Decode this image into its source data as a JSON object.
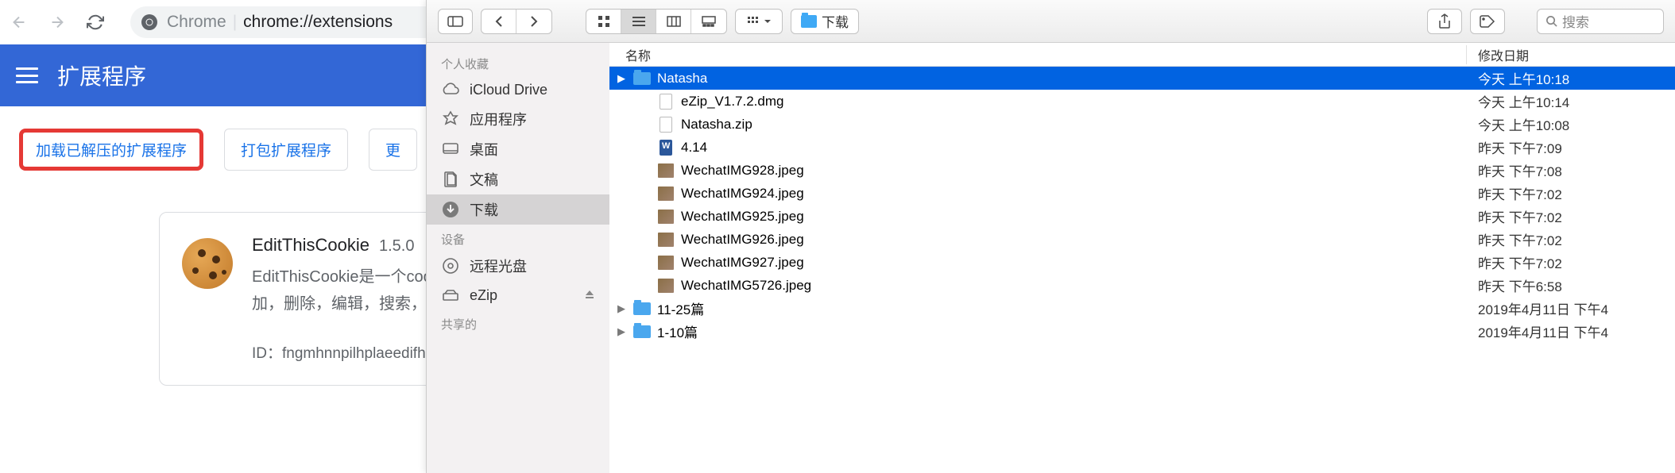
{
  "chrome": {
    "addr_prefix": "Chrome",
    "addr_path": "chrome://extensions",
    "header_title": "扩展程序",
    "btn_load": "加载已解压的扩展程序",
    "btn_pack": "打包扩展程序",
    "btn_update": "更",
    "card": {
      "title": "EditThisCookie",
      "version": "1.5.0",
      "desc1": "EditThisCookie是一个cookie管",
      "desc2": "加，删除，编辑，搜索，锁定",
      "id": "ID：fngmhnnpilhplaeedifhccc"
    }
  },
  "finder": {
    "path_label": "下载",
    "search_placeholder": "搜索",
    "sidebar": {
      "favorites_label": "个人收藏",
      "devices_label": "设备",
      "shared_label": "共享的",
      "items": [
        {
          "label": "iCloud Drive",
          "icon": "cloud"
        },
        {
          "label": "应用程序",
          "icon": "apps"
        },
        {
          "label": "桌面",
          "icon": "desktop"
        },
        {
          "label": "文稿",
          "icon": "docs"
        },
        {
          "label": "下载",
          "icon": "download"
        }
      ],
      "devices": [
        {
          "label": "远程光盘",
          "icon": "disc"
        },
        {
          "label": "eZip",
          "icon": "drive"
        }
      ]
    },
    "columns": {
      "name": "名称",
      "date": "修改日期"
    },
    "files": [
      {
        "name": "Natasha",
        "date": "今天 上午10:18",
        "type": "folder",
        "selected": true,
        "disclosure": true
      },
      {
        "name": "eZip_V1.7.2.dmg",
        "date": "今天 上午10:14",
        "type": "dmg",
        "indent": true
      },
      {
        "name": "Natasha.zip",
        "date": "今天 上午10:08",
        "type": "zip",
        "indent": true
      },
      {
        "name": "4.14",
        "date": "昨天 下午7:09",
        "type": "word",
        "indent": true
      },
      {
        "name": "WechatIMG928.jpeg",
        "date": "昨天 下午7:08",
        "type": "img",
        "indent": true
      },
      {
        "name": "WechatIMG924.jpeg",
        "date": "昨天 下午7:02",
        "type": "img",
        "indent": true
      },
      {
        "name": "WechatIMG925.jpeg",
        "date": "昨天 下午7:02",
        "type": "img",
        "indent": true
      },
      {
        "name": "WechatIMG926.jpeg",
        "date": "昨天 下午7:02",
        "type": "img",
        "indent": true
      },
      {
        "name": "WechatIMG927.jpeg",
        "date": "昨天 下午7:02",
        "type": "img",
        "indent": true
      },
      {
        "name": "WechatIMG5726.jpeg",
        "date": "昨天 下午6:58",
        "type": "img",
        "indent": true
      },
      {
        "name": "11-25篇",
        "date": "2019年4月11日 下午4",
        "type": "folder",
        "disclosure": true
      },
      {
        "name": "1-10篇",
        "date": "2019年4月11日 下午4",
        "type": "folder",
        "disclosure": true
      }
    ]
  }
}
